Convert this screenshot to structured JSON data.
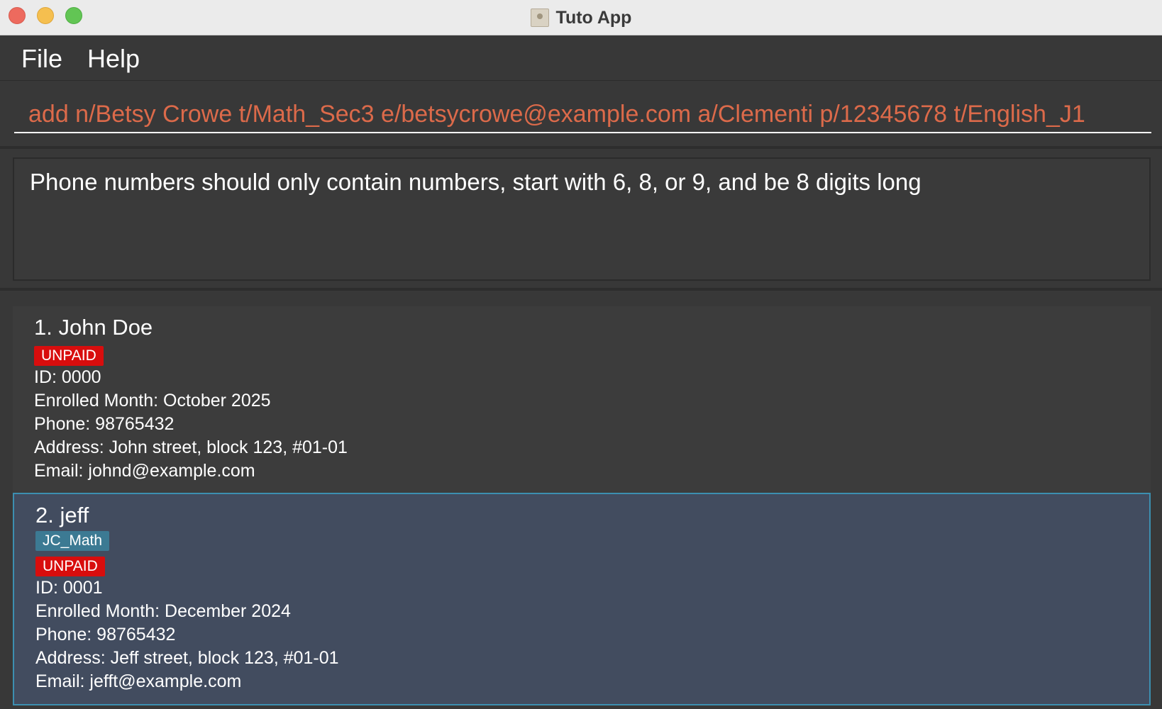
{
  "window": {
    "title": "Tuto App",
    "app_icon": "contacts-book-icon"
  },
  "menu": {
    "file": "File",
    "help": "Help"
  },
  "command": {
    "value": "add n/Betsy Crowe t/Math_Sec3 e/betsycrowe@example.com a/Clementi p/12345678 t/English_J1",
    "color": "#dc6a4a"
  },
  "result": {
    "message": "Phone numbers should only contain numbers, start with 6, 8, or 9, and be 8 digits long"
  },
  "persons": [
    {
      "name": "1. John Doe",
      "tags": [],
      "payment": "UNPAID",
      "id": "ID: 0000",
      "enrolled": "Enrolled Month: October 2025",
      "phone": "Phone: 98765432",
      "address": "Address: John street, block 123, #01-01",
      "email": "Email: johnd@example.com"
    },
    {
      "name": "2. jeff",
      "tags": [
        "JC_Math"
      ],
      "payment": "UNPAID",
      "id": "ID: 0001",
      "enrolled": "Enrolled Month: December 2024",
      "phone": "Phone: 98765432",
      "address": "Address: Jeff street, block 123, #01-01",
      "email": "Email: jefft@example.com",
      "selected": true
    }
  ],
  "colors": {
    "unpaid_tag": "#d80d0d",
    "subject_tag": "#3c7a93",
    "selected_card": "#424c5f",
    "selected_border": "#3c8fb0"
  }
}
